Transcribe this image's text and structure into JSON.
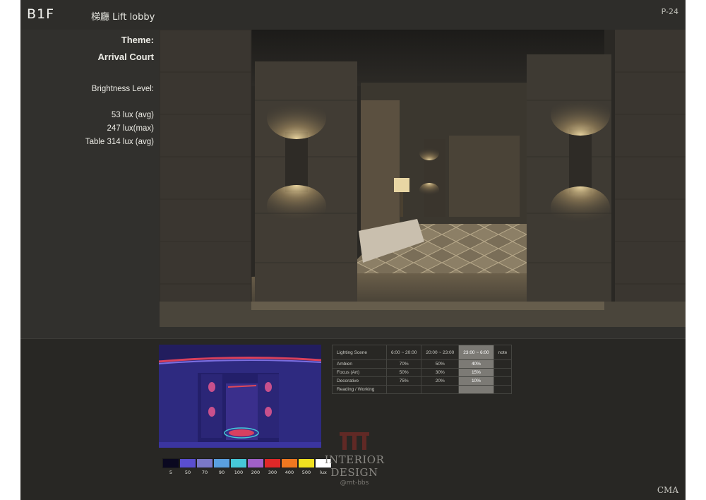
{
  "header": {
    "floor": "B1F",
    "area": "梯廳 Lift lobby",
    "page_number": "P-24"
  },
  "info": {
    "theme_label": "Theme:",
    "theme_value": "Arrival Court",
    "brightness_label": "Brightness Level:",
    "lux_avg": "53 lux (avg)",
    "lux_max": "247 lux(max)",
    "lux_table": "Table 314 lux (avg)"
  },
  "lighting_table": {
    "headers": [
      "Lighting Scene",
      "6:00 ~ 20:00",
      "20:00 ~ 23:00",
      "23:00 ~ 6:00",
      "note"
    ],
    "rows": [
      {
        "label": "Ambien",
        "v1": "70%",
        "v2": "50%",
        "v3": "40%"
      },
      {
        "label": "Focus  (Art)",
        "v1": "50%",
        "v2": "30%",
        "v3": "15%"
      },
      {
        "label": "Decorative",
        "v1": "75%",
        "v2": "20%",
        "v3": "10%"
      },
      {
        "label": "Reading / Working",
        "v1": "",
        "v2": "",
        "v3": ""
      }
    ],
    "highlight_color": "#7c7a75"
  },
  "lux_scale": {
    "labels": [
      "5",
      "50",
      "70",
      "90",
      "100",
      "200",
      "300",
      "400",
      "500",
      "lux"
    ],
    "colors": [
      "#0a0820",
      "#5a4ed0",
      "#7a78c8",
      "#5aa0e0",
      "#46c8d8",
      "#a060c8",
      "#e02828",
      "#f07820",
      "#f0e020",
      "#ffffff"
    ]
  },
  "watermark": {
    "text": "INTERIOR DESIGN",
    "sub": "@mt-bbs"
  },
  "footer": {
    "brand": "CMA"
  }
}
